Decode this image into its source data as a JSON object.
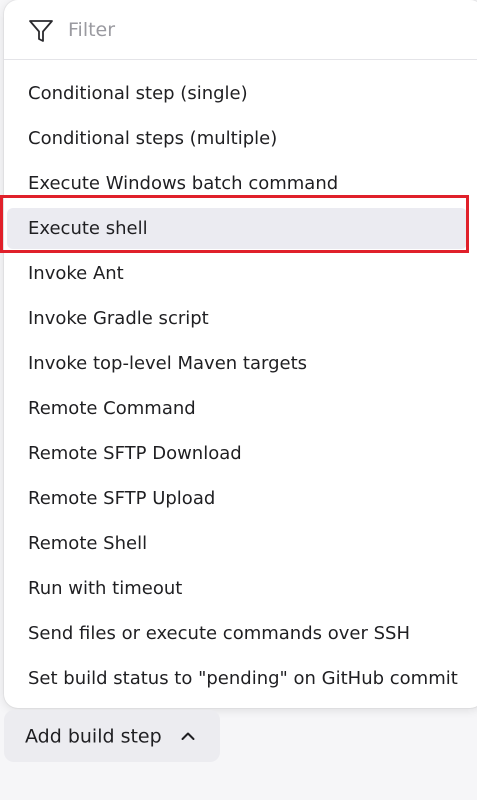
{
  "filter": {
    "placeholder": "Filter",
    "value": ""
  },
  "menu": {
    "items": [
      {
        "label": "Conditional step (single)"
      },
      {
        "label": "Conditional steps (multiple)"
      },
      {
        "label": "Execute Windows batch command"
      },
      {
        "label": "Execute shell",
        "highlighted": true
      },
      {
        "label": "Invoke Ant"
      },
      {
        "label": "Invoke Gradle script"
      },
      {
        "label": "Invoke top-level Maven targets"
      },
      {
        "label": "Remote Command"
      },
      {
        "label": "Remote SFTP Download"
      },
      {
        "label": "Remote SFTP Upload"
      },
      {
        "label": "Remote Shell"
      },
      {
        "label": "Run with timeout"
      },
      {
        "label": "Send files or execute commands over SSH"
      },
      {
        "label": "Set build status to \"pending\" on GitHub commit"
      }
    ]
  },
  "add_step_button": {
    "label": "Add build step",
    "icon": "chevron-up-icon"
  },
  "colors": {
    "highlight_border": "#e0202a",
    "hover_background": "#ebebf1",
    "button_background": "#ececf0"
  }
}
